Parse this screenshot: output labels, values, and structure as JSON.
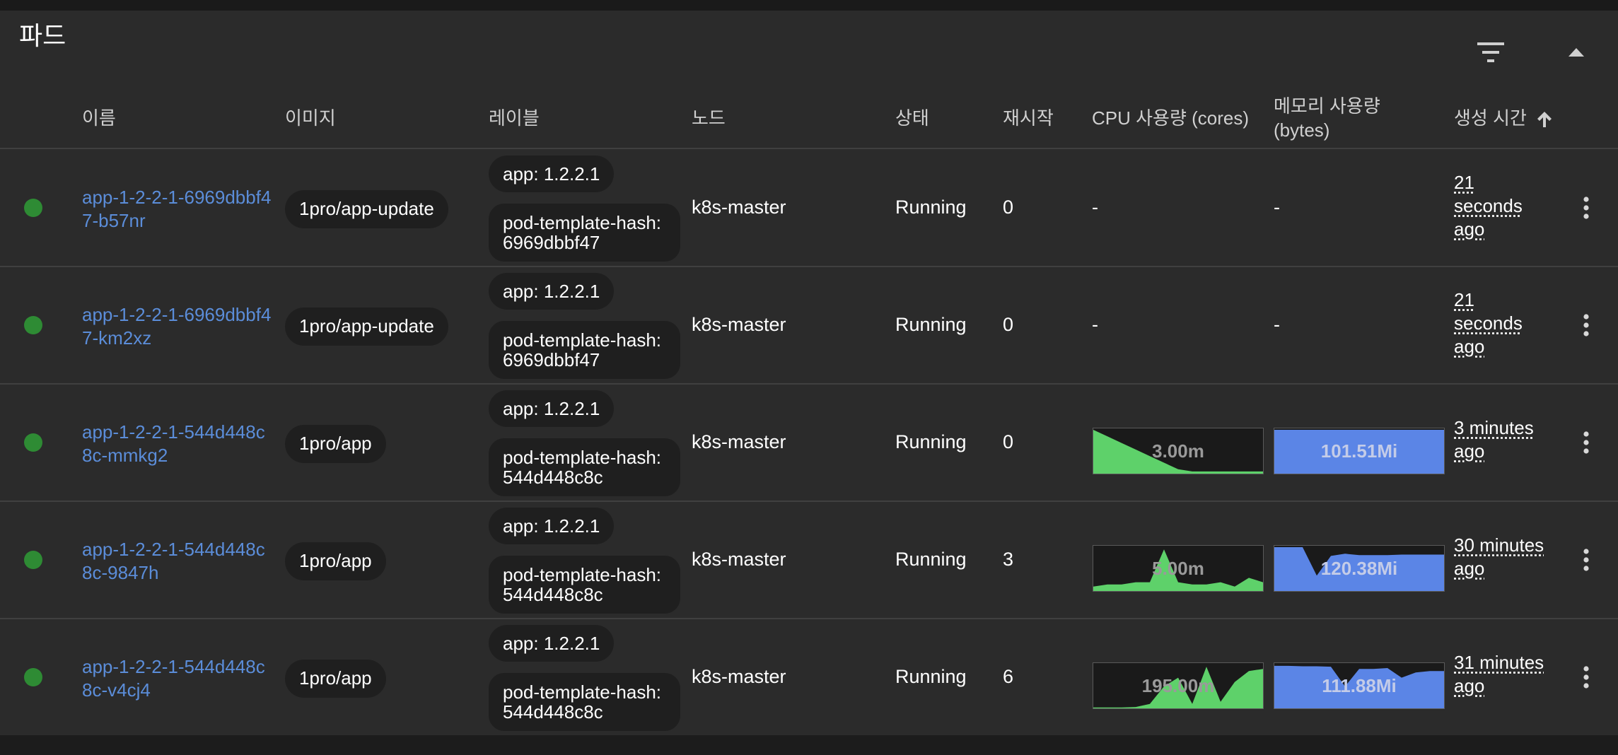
{
  "page": {
    "title": "파드"
  },
  "columns": {
    "name": "이름",
    "image": "이미지",
    "labels": "레이블",
    "node": "노드",
    "status": "상태",
    "restarts": "재시작",
    "cpu": "CPU 사용량 (cores)",
    "memory": "메모리 사용량 (bytes)",
    "created": "생성 시간"
  },
  "icons": {
    "filter": "filter-icon",
    "collapse": "chevron-up-icon",
    "sort": "arrow-up-icon",
    "more": "more-vert-icon",
    "status": "status-running-dot"
  },
  "colors": {
    "running": "#2e8b34",
    "link": "#5b8dd9",
    "cpu_fill": "#5ed16a",
    "memory_fill": "#5b85e6"
  },
  "rows": [
    {
      "name": "app-1-2-2-1-6969dbbf47-b57nr",
      "image": "1pro/app-update",
      "label_app": "app: 1.2.2.1",
      "label_hash": "pod-template-hash: 6969dbbf47",
      "node": "k8s-master",
      "status": "Running",
      "restarts": "0",
      "cpu": "-",
      "memory": "-",
      "cpu_series": [],
      "memory_series": [],
      "created": "21 seconds ago"
    },
    {
      "name": "app-1-2-2-1-6969dbbf47-km2xz",
      "image": "1pro/app-update",
      "label_app": "app: 1.2.2.1",
      "label_hash": "pod-template-hash: 6969dbbf47",
      "node": "k8s-master",
      "status": "Running",
      "restarts": "0",
      "cpu": "-",
      "memory": "-",
      "cpu_series": [],
      "memory_series": [],
      "created": "21 seconds ago"
    },
    {
      "name": "app-1-2-2-1-544d448c8c-mmkg2",
      "image": "1pro/app",
      "label_app": "app: 1.2.2.1",
      "label_hash": "pod-template-hash: 544d448c8c",
      "node": "k8s-master",
      "status": "Running",
      "restarts": "0",
      "cpu": "3.00m",
      "memory": "101.51Mi",
      "cpu_series": [
        1.0,
        0.85,
        0.7,
        0.55,
        0.4,
        0.25,
        0.1,
        0.05,
        0.05,
        0.05,
        0.05,
        0.05,
        0.05
      ],
      "memory_series": [
        1,
        1,
        1,
        1,
        1,
        1,
        1,
        1,
        1,
        1,
        1,
        1,
        1
      ],
      "created": "3 minutes ago"
    },
    {
      "name": "app-1-2-2-1-544d448c8c-9847h",
      "image": "1pro/app",
      "label_app": "app: 1.2.2.1",
      "label_hash": "pod-template-hash: 544d448c8c",
      "node": "k8s-master",
      "status": "Running",
      "restarts": "3",
      "cpu": "5.00m",
      "memory": "120.38Mi",
      "cpu_series": [
        0.1,
        0.15,
        0.15,
        0.2,
        0.2,
        0.95,
        0.2,
        0.15,
        0.15,
        0.2,
        0.1,
        0.3,
        0.2
      ],
      "memory_series": [
        1.0,
        1.0,
        1.0,
        0.35,
        0.8,
        0.85,
        0.82,
        0.82,
        0.82,
        0.83,
        0.83,
        0.83,
        0.83
      ],
      "created": "30 minutes ago"
    },
    {
      "name": "app-1-2-2-1-544d448c8c-v4cj4",
      "image": "1pro/app",
      "label_app": "app: 1.2.2.1",
      "label_hash": "pod-template-hash: 544d448c8c",
      "node": "k8s-master",
      "status": "Running",
      "restarts": "6",
      "cpu": "195.00m",
      "memory": "111.88Mi",
      "cpu_series": [
        0.02,
        0.02,
        0.02,
        0.03,
        0.1,
        0.5,
        0.7,
        0.1,
        0.95,
        0.15,
        0.6,
        0.85,
        0.9
      ],
      "memory_series": [
        0.97,
        0.97,
        0.96,
        0.96,
        0.95,
        0.5,
        0.9,
        0.9,
        0.92,
        0.7,
        0.82,
        0.85,
        0.85
      ],
      "created": "31 minutes ago"
    }
  ]
}
